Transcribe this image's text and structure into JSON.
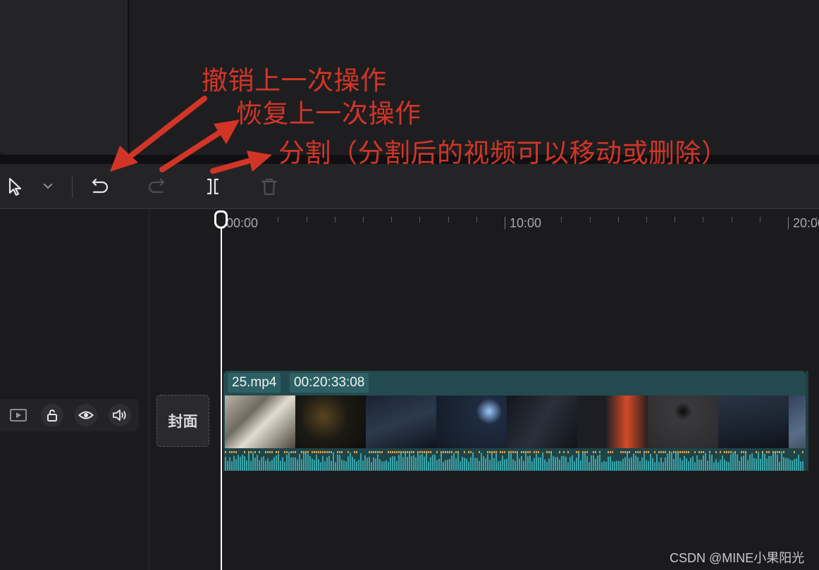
{
  "toolbar": {
    "select_tool": "select-pointer",
    "undo": "undo",
    "redo": "redo",
    "split": "split",
    "delete": "delete"
  },
  "ruler": {
    "labels": [
      "00:00",
      "10:00",
      "20:00"
    ]
  },
  "track": {
    "cover_label": "封面"
  },
  "clip": {
    "filename": "25.mp4",
    "duration": "00:20:33:08"
  },
  "annotations": {
    "undo_note": "撤销上一次操作",
    "redo_note": "恢复上一次操作",
    "split_note": "分割（分割后的视频可以移动或删除）"
  },
  "watermark": "CSDN @MINE小果阳光",
  "colors": {
    "annotation": "#d23527",
    "clip": "#234b4f",
    "playhead": "#ffffff"
  }
}
